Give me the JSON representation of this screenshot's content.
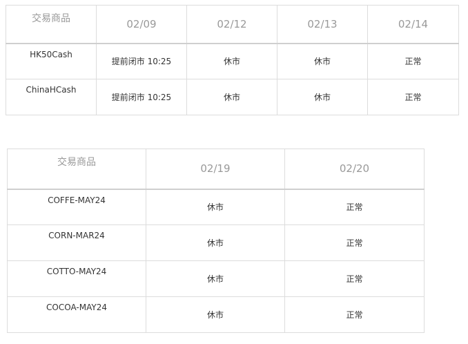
{
  "tables": [
    {
      "headers": [
        "交易商品",
        "02/09",
        "02/12",
        "02/13",
        "02/14"
      ],
      "rows": [
        [
          "HK50Cash",
          "提前闭市 10:25",
          "休市",
          "休市",
          "正常"
        ],
        [
          "ChinaHCash",
          "提前闭市 10:25",
          "休市",
          "休市",
          "正常"
        ]
      ]
    },
    {
      "headers": [
        "交易商品",
        "02/19",
        "02/20"
      ],
      "rows": [
        [
          "COFFE-MAY24",
          "休市",
          "正常"
        ],
        [
          "CORN-MAR24",
          "休市",
          "正常"
        ],
        [
          "COTTO-MAY24",
          "休市",
          "正常"
        ],
        [
          "COCOA-MAY24",
          "休市",
          "正常"
        ]
      ]
    }
  ]
}
